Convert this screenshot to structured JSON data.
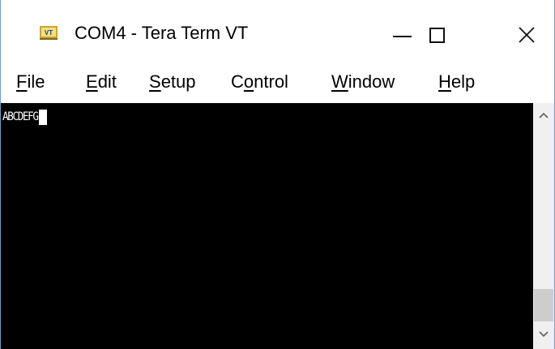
{
  "window": {
    "title": "COM4 - Tera Term VT",
    "icon": "tera-term-vt-icon",
    "buttons": {
      "minimize": "minimize-icon",
      "maximize": "maximize-icon",
      "close": "close-icon"
    }
  },
  "menu": {
    "items": [
      {
        "mnemonic": "F",
        "rest": "ile"
      },
      {
        "mnemonic": "E",
        "rest": "dit"
      },
      {
        "mnemonic": "S",
        "rest": "etup"
      },
      {
        "pre": "C",
        "mnemonic": "o",
        "rest": "ntrol"
      },
      {
        "mnemonic": "W",
        "rest": "indow"
      },
      {
        "mnemonic": "H",
        "rest": "elp"
      }
    ]
  },
  "terminal": {
    "line": "ABCDEFG",
    "background": "#000000",
    "foreground": "#ffffff"
  },
  "scrollbar": {
    "up_icon": "chevron-up-icon",
    "down_icon": "chevron-down-icon"
  }
}
